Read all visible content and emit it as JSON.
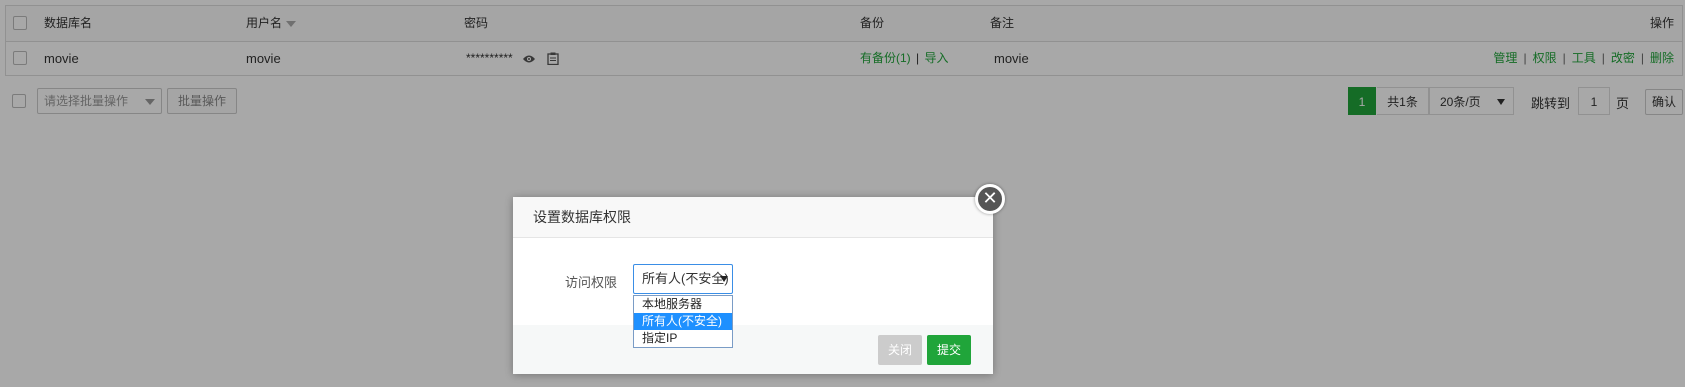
{
  "table": {
    "headers": {
      "db_name": "数据库名",
      "username": "用户名",
      "password": "密码",
      "backup": "备份",
      "note": "备注",
      "actions": "操作"
    },
    "row": {
      "db_name": "movie",
      "username": "movie",
      "password_mask": "**********",
      "backup_link": "有备份(1)",
      "backup_sep": "|",
      "import_link": "导入",
      "note": "movie",
      "actions": [
        "管理",
        "权限",
        "工具",
        "改密",
        "删除"
      ],
      "action_sep": "|"
    }
  },
  "toolbar": {
    "batch_select_placeholder": "请选择批量操作",
    "batch_button": "批量操作"
  },
  "pager": {
    "current_page": "1",
    "total": "共1条",
    "page_size": "20条/页",
    "jump_label": "跳转到",
    "jump_value": "1",
    "page_unit": "页",
    "confirm": "确认"
  },
  "modal": {
    "title": "设置数据库权限",
    "field_label": "访问权限",
    "selected_value": "所有人(不安全)",
    "options": [
      "本地服务器",
      "所有人(不安全)",
      "指定IP"
    ],
    "selected_index": 1,
    "close_button": "关闭",
    "submit_button": "提交",
    "close_icon_glyph": "✕"
  },
  "colors": {
    "accent_green": "#20a53a",
    "select_highlight": "#1e90ff",
    "overlay": "rgba(0,0,0,0.34)"
  }
}
